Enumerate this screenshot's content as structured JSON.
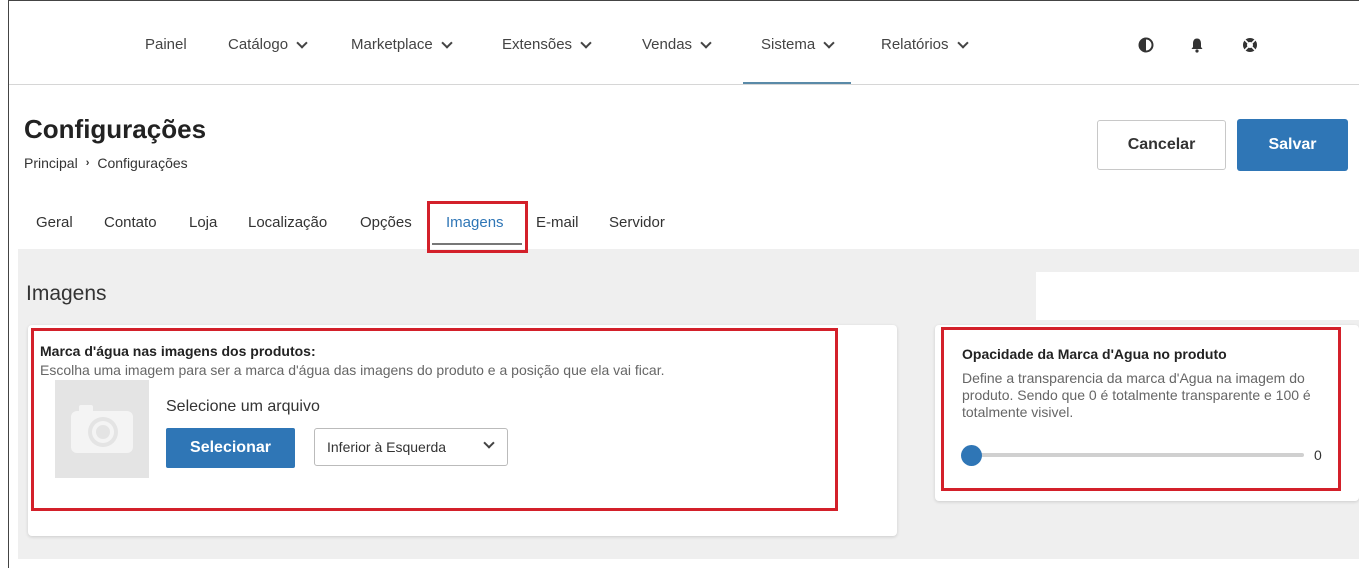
{
  "nav": {
    "items": [
      {
        "label": "Painel",
        "dropdown": false
      },
      {
        "label": "Catálogo",
        "dropdown": true
      },
      {
        "label": "Marketplace",
        "dropdown": true
      },
      {
        "label": "Extensões",
        "dropdown": true
      },
      {
        "label": "Vendas",
        "dropdown": true
      },
      {
        "label": "Sistema",
        "dropdown": true,
        "active": true
      },
      {
        "label": "Relatórios",
        "dropdown": true
      }
    ],
    "icons": [
      "contrast-icon",
      "bell-icon",
      "help-icon"
    ]
  },
  "header": {
    "title": "Configurações",
    "breadcrumb": [
      "Principal",
      "Configurações"
    ],
    "breadcrumb_separator": "›",
    "cancel_label": "Cancelar",
    "save_label": "Salvar"
  },
  "tabs": [
    {
      "label": "Geral"
    },
    {
      "label": "Contato"
    },
    {
      "label": "Loja"
    },
    {
      "label": "Localização"
    },
    {
      "label": "Opções"
    },
    {
      "label": "Imagens",
      "active": true
    },
    {
      "label": "E-mail"
    },
    {
      "label": "Servidor"
    }
  ],
  "section": {
    "title": "Imagens"
  },
  "watermark": {
    "title": "Marca d'água nas imagens dos produtos:",
    "description": "Escolha uma imagem para ser a marca d'água das imagens do produto e a posição que ela vai ficar.",
    "file_label": "Selecione um arquivo",
    "select_button": "Selecionar",
    "position_selected": "Inferior à Esquerda"
  },
  "opacity": {
    "title": "Opacidade da Marca d'Agua no produto",
    "description": "Define a transparencia da marca d'Agua na imagem do produto. Sendo que 0 é totalmente transparente e 100 é totalmente visivel.",
    "value": "0",
    "min": 0,
    "max": 100
  },
  "colors": {
    "primary": "#2f76b6",
    "highlight": "#d3202a"
  }
}
